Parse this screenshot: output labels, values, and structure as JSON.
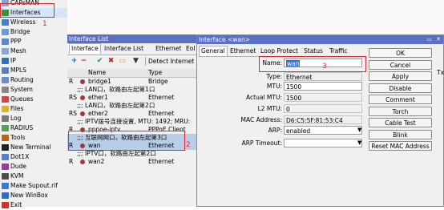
{
  "sidebar": {
    "items": [
      {
        "label": "CAPsMAN",
        "icon_color": "#7aa7d8"
      },
      {
        "label": "Interfaces",
        "icon_color": "#3c8f3c"
      },
      {
        "label": "Wireless",
        "icon_color": "#4a7fc6"
      },
      {
        "label": "Bridge",
        "icon_color": "#6e9bd1"
      },
      {
        "label": "PPP",
        "icon_color": "#5b8ac9"
      },
      {
        "label": "Mesh",
        "icon_color": "#8aa8d2"
      },
      {
        "label": "IP",
        "icon_color": "#3a6fb5"
      },
      {
        "label": "MPLS",
        "icon_color": "#5d7fb8"
      },
      {
        "label": "Routing",
        "icon_color": "#6b8fc2"
      },
      {
        "label": "System",
        "icon_color": "#888888"
      },
      {
        "label": "Queues",
        "icon_color": "#d04545"
      },
      {
        "label": "Files",
        "icon_color": "#d9b23c"
      },
      {
        "label": "Log",
        "icon_color": "#7a7a7a"
      },
      {
        "label": "RADIUS",
        "icon_color": "#5c9c5c"
      },
      {
        "label": "Tools",
        "icon_color": "#b5651d"
      },
      {
        "label": "New Terminal",
        "icon_color": "#222222"
      },
      {
        "label": "Dot1X",
        "icon_color": "#5b7fc4"
      },
      {
        "label": "Dude",
        "icon_color": "#9a3b9a"
      },
      {
        "label": "KVM",
        "icon_color": "#4d4d4d"
      },
      {
        "label": "Make Supout.rif",
        "icon_color": "#3d7ccb"
      },
      {
        "label": "New WinBox",
        "icon_color": "#2f6fc0"
      },
      {
        "label": "Exit",
        "icon_color": "#cc3333"
      }
    ],
    "active_index": 1,
    "annotation_number": "1"
  },
  "interface_list": {
    "title": "Interface List",
    "tabs": [
      "Interface",
      "Interface List",
      "Ethernet",
      "EoI"
    ],
    "active_tab": 0,
    "toolbar": {
      "add": "+",
      "remove": "−",
      "enable": "✔",
      "disable": "✖",
      "comment": "▭",
      "filter": "▼",
      "detect_internet_label": "Detect Internet"
    },
    "columns": [
      "Name",
      "Type"
    ],
    "rows": [
      {
        "flag": "R",
        "name": "bridge1",
        "type": "Bridge",
        "comment": false,
        "selected": false
      },
      {
        "flag": "",
        "name": ";;; LAN口，软路由左起第1口",
        "type": "",
        "comment": true,
        "selected": false
      },
      {
        "flag": "RS",
        "name": "ether1",
        "type": "Ethernet",
        "comment": false,
        "selected": false
      },
      {
        "flag": "",
        "name": ";;; LAN口，软路由左起第2口",
        "type": "",
        "comment": true,
        "selected": false
      },
      {
        "flag": "RS",
        "name": "ether2",
        "type": "Ethernet",
        "comment": false,
        "selected": false
      },
      {
        "flag": "",
        "name": ";;; IPTV拨号连接设置, MTU: 1492; MRU:",
        "type": "",
        "comment": true,
        "selected": false
      },
      {
        "flag": "R",
        "name": "pppoe-iptv",
        "type": "PPPoE Client",
        "comment": false,
        "selected": false
      },
      {
        "flag": "",
        "name": ";;; 互联网网口，软路由左起第3口",
        "type": "",
        "comment": true,
        "selected": true
      },
      {
        "flag": "R",
        "name": "wan",
        "type": "Ethernet",
        "comment": false,
        "selected": true
      },
      {
        "flag": "",
        "name": ";;; IPTV口，软路由左起第2口",
        "type": "",
        "comment": true,
        "selected": false
      },
      {
        "flag": "R",
        "name": "wan2",
        "type": "Ethernet",
        "comment": false,
        "selected": false
      }
    ],
    "annotation_number": "2"
  },
  "dialog": {
    "title": "Interface <wan>",
    "window_buttons": [
      "▭",
      "✕"
    ],
    "tabs": [
      "General",
      "Ethernet",
      "Loop Protect",
      "Status",
      "Traffic"
    ],
    "active_tab": 0,
    "fields": [
      {
        "label": "Name:",
        "value": "wan",
        "editable": true
      },
      {
        "label": "Type:",
        "value": "Ethernet",
        "editable": false
      },
      {
        "label": "MTU:",
        "value": "1500",
        "editable": true
      },
      {
        "label": "Actual MTU:",
        "value": "1500",
        "editable": false
      },
      {
        "label": "L2 MTU:",
        "value": "0",
        "editable": false
      },
      {
        "label": "MAC Address:",
        "value": "D6:C5:5F:81:53:C4",
        "editable": false
      },
      {
        "label": "ARP:",
        "value": "enabled",
        "editable": true
      },
      {
        "label": "ARP Timeout:",
        "value": "",
        "editable": true
      }
    ],
    "buttons": [
      "OK",
      "Cancel",
      "Apply",
      "Disable",
      "Comment",
      "Torch",
      "Cable Test",
      "Blink",
      "Reset MAC Address"
    ],
    "annotation_number": "3",
    "right_edge_text": "Tx"
  }
}
